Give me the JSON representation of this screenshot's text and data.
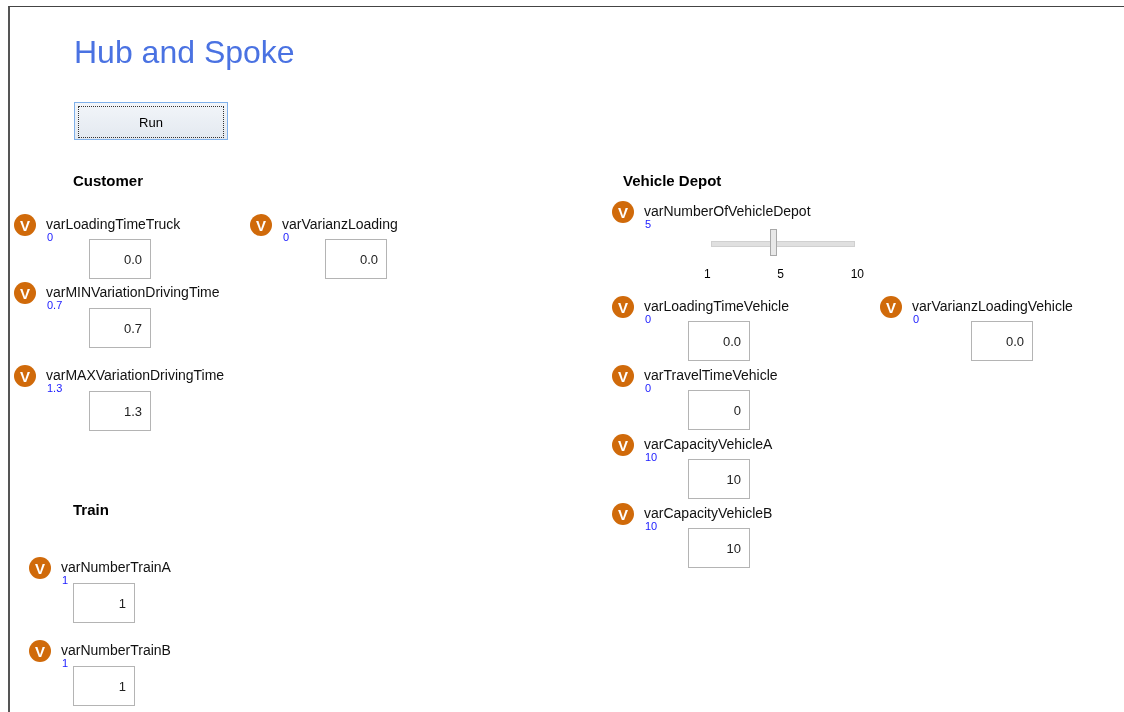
{
  "title": "Hub and Spoke",
  "run_button": "Run",
  "sections": [
    {
      "heading": "Customer",
      "variables": [
        {
          "kind": "field",
          "icon": "V",
          "name": "varLoadingTimeTruck",
          "value": "0",
          "field": "0.0"
        },
        {
          "kind": "field",
          "icon": "V",
          "name": "varVarianzLoading",
          "value": "0",
          "field": "0.0"
        },
        {
          "kind": "field",
          "icon": "V",
          "name": "varMINVariationDrivingTime",
          "value": "0.7",
          "field": "0.7"
        },
        {
          "kind": "field",
          "icon": "V",
          "name": "varMAXVariationDrivingTime",
          "value": "1.3",
          "field": "1.3"
        }
      ]
    },
    {
      "heading": "Train",
      "variables": [
        {
          "kind": "field",
          "icon": "V",
          "name": "varNumberTrainA",
          "value": "1",
          "field": "1"
        },
        {
          "kind": "field",
          "icon": "V",
          "name": "varNumberTrainB",
          "value": "1",
          "field": "1"
        }
      ]
    },
    {
      "heading": "Vehicle Depot",
      "variables": [
        {
          "kind": "slider",
          "icon": "V",
          "name": "varNumberOfVehicleDepot",
          "value": "5",
          "level": 0.44,
          "ticks": [
            "1",
            "5",
            "10"
          ]
        },
        {
          "kind": "field",
          "icon": "V",
          "name": "varLoadingTimeVehicle",
          "value": "0",
          "field": "0.0"
        },
        {
          "kind": "field",
          "icon": "V",
          "name": "varVarianzLoadingVehicle",
          "value": "0",
          "field": "0.0"
        },
        {
          "kind": "field",
          "icon": "V",
          "name": "varTravelTimeVehicle",
          "value": "0",
          "field": "0"
        },
        {
          "kind": "field",
          "icon": "V",
          "name": "varCapacityVehicleA",
          "value": "10",
          "field": "10"
        },
        {
          "kind": "field",
          "icon": "V",
          "name": "varCapacityVehicleB",
          "value": "10",
          "field": "10"
        }
      ]
    }
  ]
}
